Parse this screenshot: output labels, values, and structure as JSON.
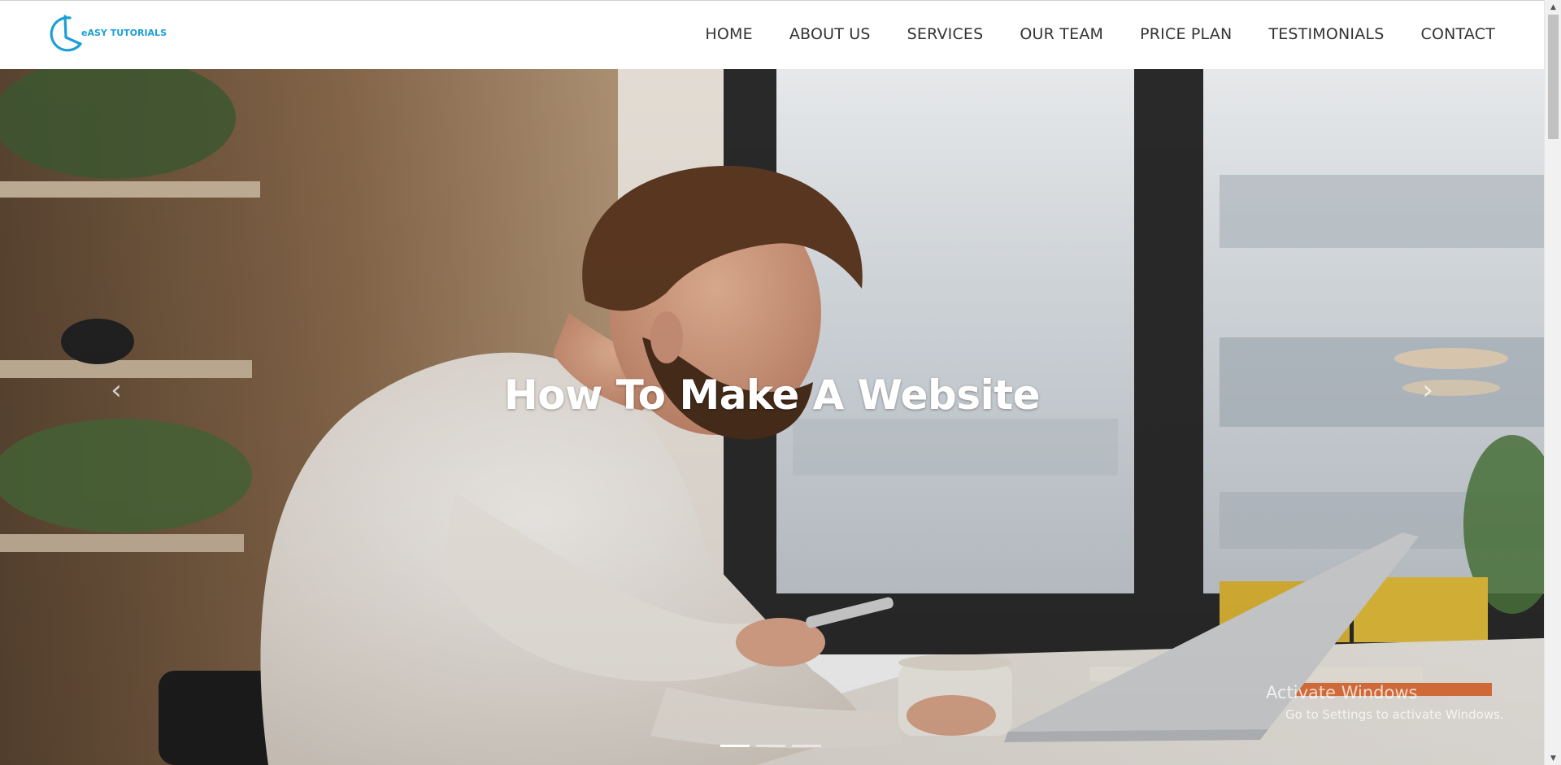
{
  "brand": {
    "name": "eASY TUTORIALS",
    "color": "#1a9fd6"
  },
  "nav": {
    "items": [
      {
        "label": "HOME"
      },
      {
        "label": "ABOUT US"
      },
      {
        "label": "SERVICES"
      },
      {
        "label": "OUR TEAM"
      },
      {
        "label": "PRICE PLAN"
      },
      {
        "label": "TESTIMONIALS"
      },
      {
        "label": "CONTACT"
      }
    ]
  },
  "hero": {
    "caption": "How To Make A Website",
    "prev_icon": "chevron-left-icon",
    "next_icon": "chevron-right-icon",
    "slide_count": 3,
    "active_slide": 1
  },
  "watermark": {
    "title": "Activate Windows",
    "subtitle": "Go to Settings to activate Windows."
  },
  "scrollbar": {
    "up_icon": "scroll-up-arrow-icon",
    "down_icon": "scroll-down-arrow-icon"
  }
}
